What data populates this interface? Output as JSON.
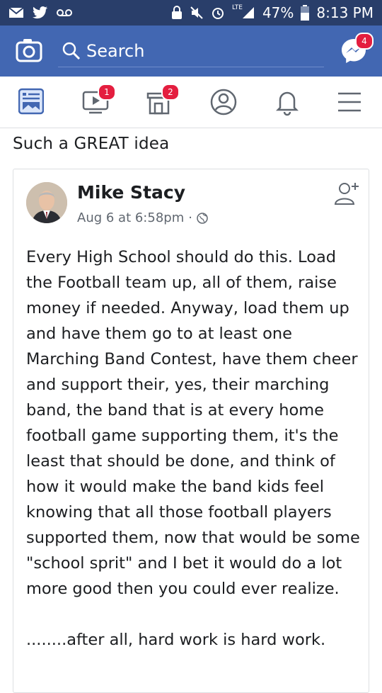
{
  "status_bar": {
    "battery": "47%",
    "time": "8:13 PM",
    "network": "LTE"
  },
  "header": {
    "search_placeholder": "Search",
    "messenger_badge": "4"
  },
  "tabs": {
    "watch_badge": "1",
    "marketplace_badge": "2"
  },
  "post": {
    "caption": "Such a GREAT idea",
    "shared": {
      "author": "Mike Stacy",
      "timestamp": "Aug 6 at 6:58pm",
      "separator": "·",
      "text": "Every High School should do this. Load the Football team up, all of them, raise money if needed. Anyway, load them up and have them go to at least one Marching Band Contest, have them cheer and support their, yes, their marching band, the band that is at every home football game supporting them, it's the least that should be done, and think of how it would make the band kids feel knowing that all those football players supported them, now that would be some \"school sprit\" and I bet it would do a lot more good then you could ever realize.\n\n........after all, hard work is hard work."
    }
  },
  "colors": {
    "status_bar": "#293e6a",
    "header": "#4267b2",
    "badge": "#e41e3f",
    "icon_blue": "#4267b2",
    "icon_gray": "#606770"
  }
}
